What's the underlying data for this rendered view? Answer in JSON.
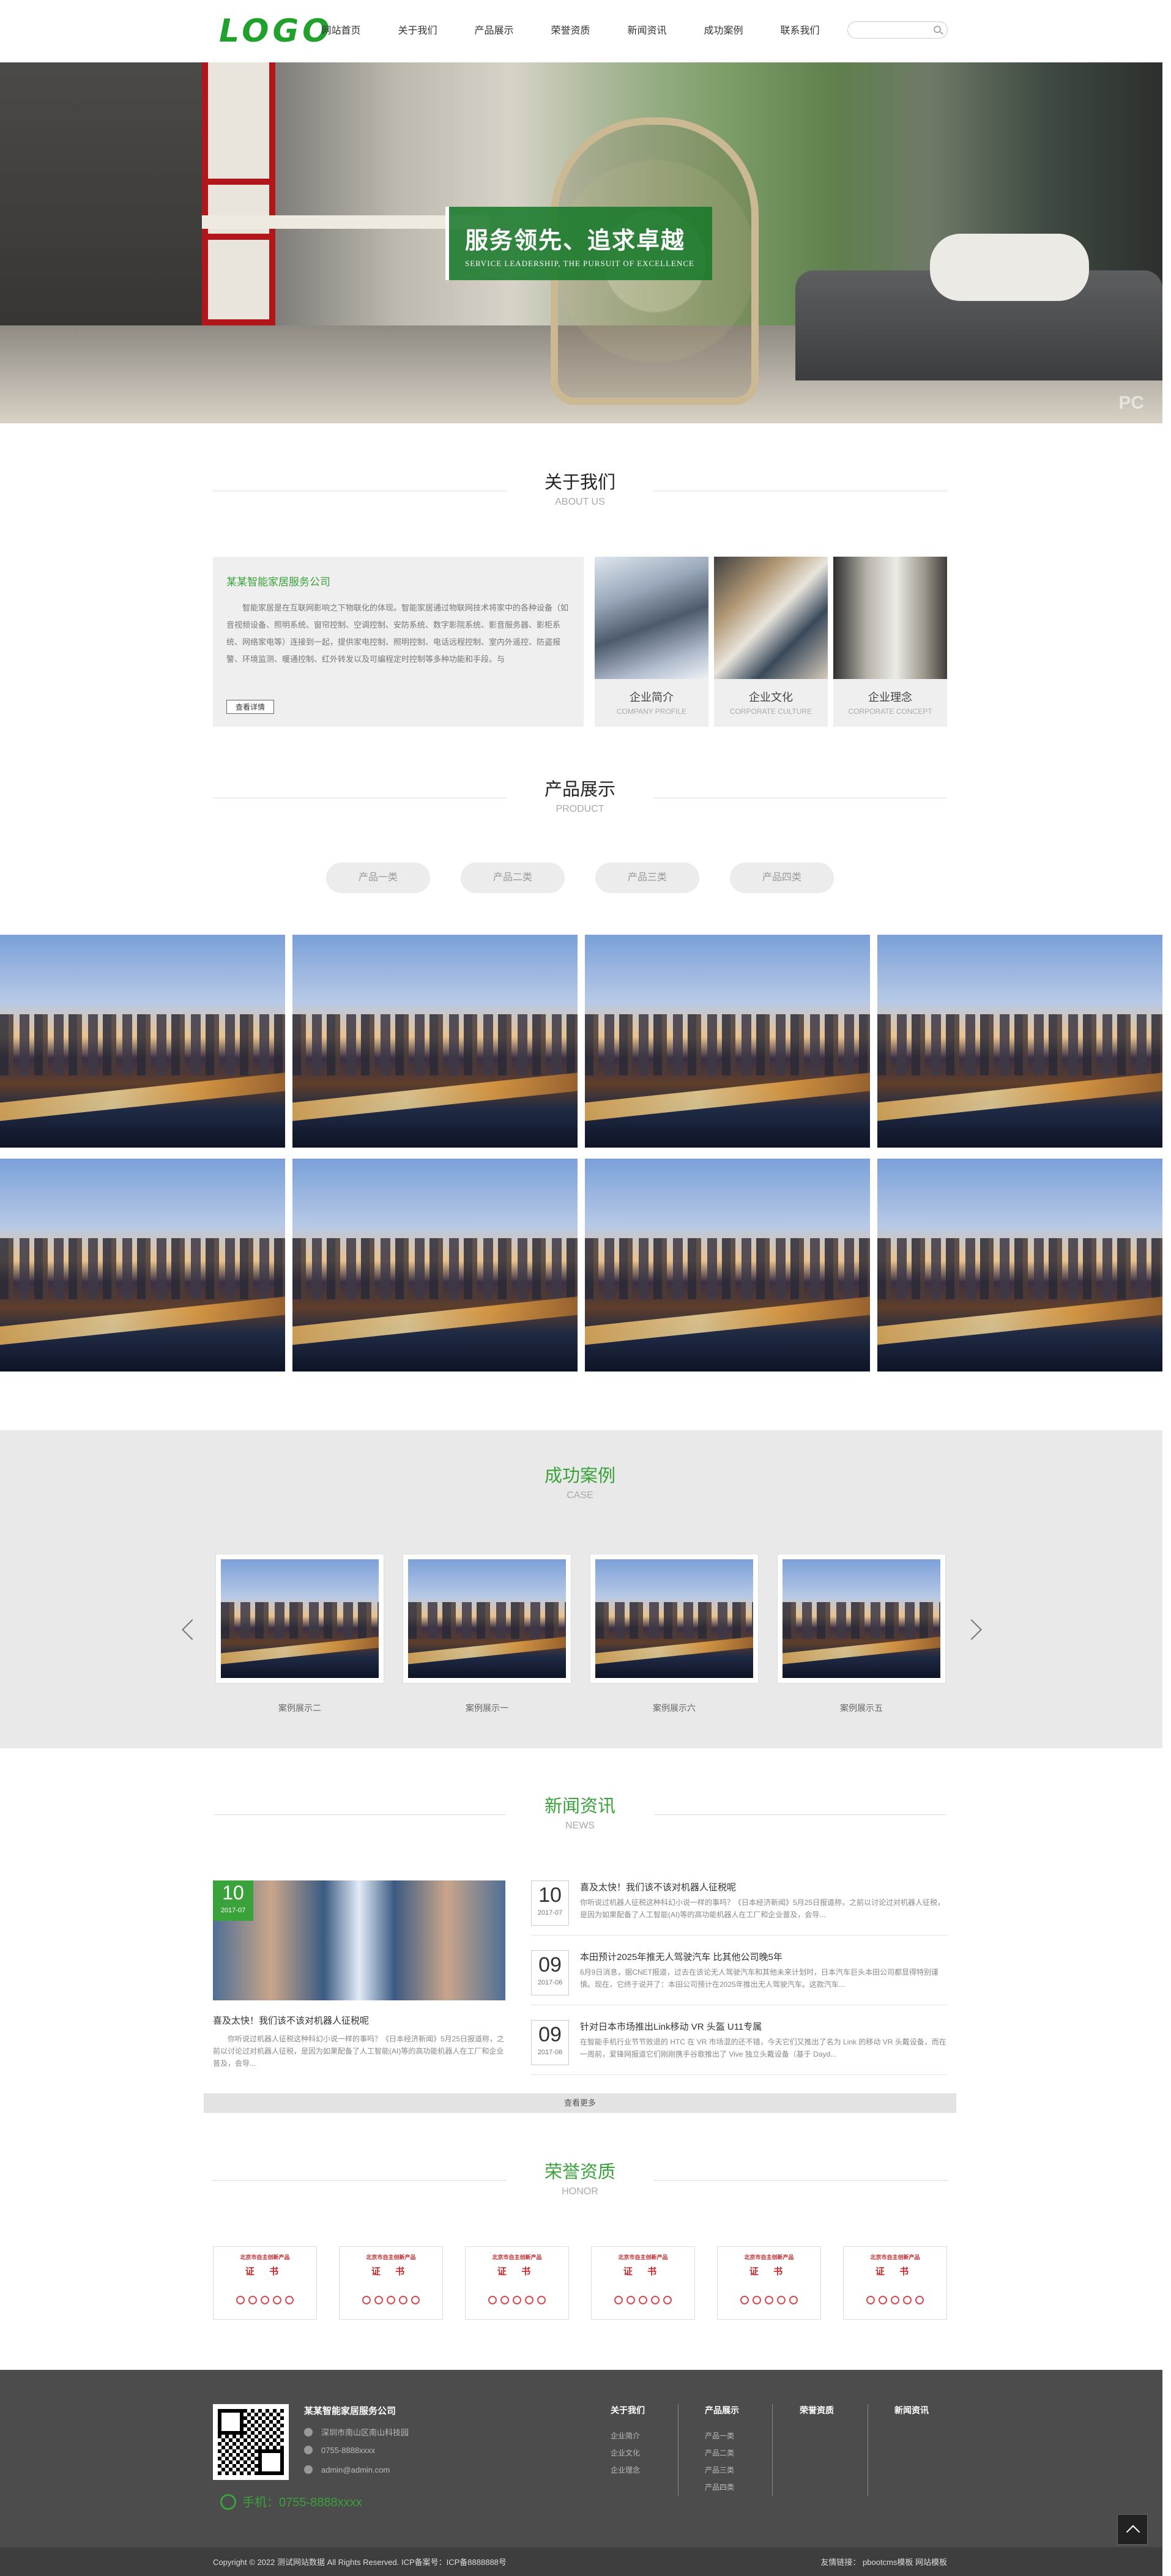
{
  "header": {
    "logo": "LOGO",
    "nav": [
      "网站首页",
      "关于我们",
      "产品展示",
      "荣誉资质",
      "新闻资讯",
      "成功案例",
      "联系我们"
    ],
    "search_placeholder": ""
  },
  "banner": {
    "title": "服务领先、追求卓越",
    "subtitle": "SERVICE LEADERSHIP, THE PURSUIT OF EXCELLENCE",
    "watermark": "PC"
  },
  "about": {
    "title": "关于我们",
    "subtitle": "ABOUT US",
    "company": "某某智能家居服务公司",
    "text": "智能家居是在互联网影响之下物联化的体现。智能家居通过物联网技术将家中的各种设备（如音视频设备、照明系统、窗帘控制、空调控制、安防系统、数字影院系统、影音服务器、影柜系统、网络家电等）连接到一起，提供家电控制、照明控制、电话远程控制、室内外遥控、防盗报警、环境监测、暖通控制、红外转发以及可编程定时控制等多种功能和手段。与",
    "more": "查看详情",
    "cards": [
      {
        "title": "企业简介",
        "en": "COMPANY PROFILE"
      },
      {
        "title": "企业文化",
        "en": "CORPORATE CULTURE"
      },
      {
        "title": "企业理念",
        "en": "CORPORATE CONCEPT"
      }
    ]
  },
  "products": {
    "title": "产品展示",
    "subtitle": "PRODUCT",
    "tabs": [
      "产品一类",
      "产品二类",
      "产品三类",
      "产品四类"
    ]
  },
  "cases": {
    "title": "成功案例",
    "subtitle": "CASE",
    "items": [
      "案例展示二",
      "案例展示一",
      "案例展示六",
      "案例展示五"
    ]
  },
  "news": {
    "title": "新闻资讯",
    "subtitle": "NEWS",
    "featured": {
      "day": "10",
      "ym": "2017-07",
      "title": "喜及太快！我们该不该对机器人征税呢",
      "text": "你听说过机器人征税这种科幻小说一样的事吗？《日本经济新闻》5月25日报道称，之前以讨论过对机器人征税，是因为如果配备了人工智能(AI)等的高功能机器人在工厂和企业普及，会导..."
    },
    "items": [
      {
        "day": "10",
        "ym": "2017-07",
        "title": "喜及太快！我们该不该对机器人征税呢",
        "text": "你听说过机器人征税这种科幻小说一样的事吗？《日本经济新闻》5月25日报道称，之前以讨论过对机器人征税，是因为如果配备了人工智能(AI)等的高功能机器人在工厂和企业普及，会导..."
      },
      {
        "day": "09",
        "ym": "2017-06",
        "title": "本田预计2025年推无人驾驶汽车 比其他公司晚5年",
        "text": "6月9日消息，据CNET报道，过去在该论无人驾驶汽车和其他未来计划时，日本汽车巨头本田公司都显得特别谨慎。现在，它终于说开了：本田公司预计在2025年推出无人驾驶汽车。这款汽车..."
      },
      {
        "day": "09",
        "ym": "2017-06",
        "title": "针对日本市场推出Link移动 VR 头盔 U11专属",
        "text": "在智能手机行业节节败退的 HTC 在 VR 市场混的还不错，今天它们又推出了名为 Link 的移动 VR 头戴设备，而在一周前，爱锋网报道它们刚刚携手谷歌推出了 Vive 独立头戴设备（基于 Dayd..."
      }
    ],
    "more": "查看更多"
  },
  "honor": {
    "title": "荣誉资质",
    "subtitle": "HONOR",
    "cert_head": "北京市自主创新产品",
    "cert_word": "证 书",
    "count": 6
  },
  "footer": {
    "company": "某某智能家居服务公司",
    "address": "深圳市南山区南山科技园",
    "tel": "0755-8888xxxx",
    "email": "admin@admin.com",
    "phone": "手机：0755-8888xxxx",
    "cols": [
      {
        "title": "关于我们",
        "links": [
          "企业简介",
          "企业文化",
          "企业理念"
        ]
      },
      {
        "title": "产品展示",
        "links": [
          "产品一类",
          "产品二类",
          "产品三类",
          "产品四类"
        ]
      },
      {
        "title": "荣誉资质",
        "links": []
      },
      {
        "title": "新闻资讯",
        "links": []
      }
    ],
    "copyright": "Copyright © 2022 测试网站数据 All Rights Reserved.  ICP备案号：ICP备8888888号",
    "links": "友情链接：  pbootcms模板  网站模板"
  }
}
